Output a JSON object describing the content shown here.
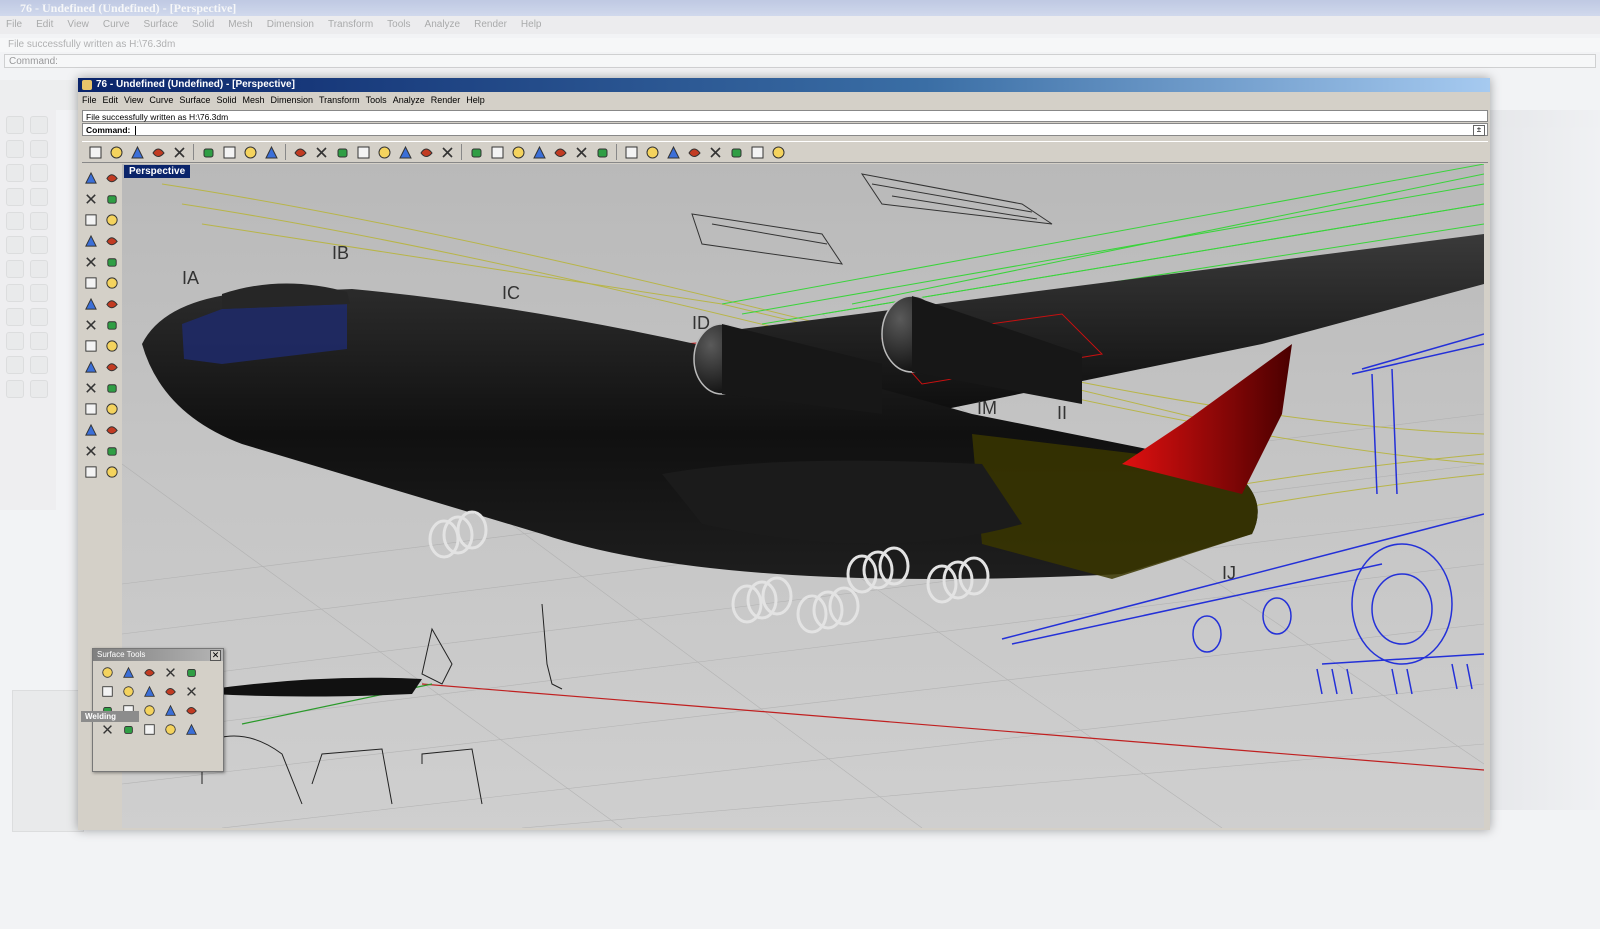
{
  "background_window": {
    "title": "76 - Undefined (Undefined) - [Perspective]",
    "menu": [
      "File",
      "Edit",
      "View",
      "Curve",
      "Surface",
      "Solid",
      "Mesh",
      "Dimension",
      "Transform",
      "Tools",
      "Analyze",
      "Render",
      "Help"
    ],
    "status": "File successfully written as H:\\76.3dm",
    "command_label": "Command:"
  },
  "window": {
    "title": "76 - Undefined (Undefined) - [Perspective]"
  },
  "menu": [
    "File",
    "Edit",
    "View",
    "Curve",
    "Surface",
    "Solid",
    "Mesh",
    "Dimension",
    "Transform",
    "Tools",
    "Analyze",
    "Render",
    "Help"
  ],
  "status_line": "File successfully written as H:\\76.3dm",
  "command": {
    "label": "Command:",
    "value": ""
  },
  "toolbar_icons": [
    "new-icon",
    "open-icon",
    "save-icon",
    "print-icon",
    "import-icon",
    "cut-icon",
    "copy-icon",
    "paste-icon",
    "undo-icon",
    "pan-hand-icon",
    "move-icon",
    "zoom-icon",
    "zoom-window-icon",
    "zoom-extents-icon",
    "zoom-selected-icon",
    "rotate-view-icon",
    "four-viewports-icon",
    "hide-icon",
    "show-icon",
    "layer-icon",
    "snap-icon",
    "bulb-icon",
    "lock-icon",
    "properties-icon",
    "color-wheel-icon",
    "sphere-wire-icon",
    "sphere-shade-icon",
    "render-icon",
    "analyze-icon",
    "settings-gear-icon",
    "options-icon",
    "help-icon"
  ],
  "sidebar_icons": [
    "select-arrow-icon",
    "point-icon",
    "polyline-icon",
    "curve-points-icon",
    "circle-icon",
    "ellipse-icon",
    "polygon-icon",
    "rectangle-icon",
    "arc-icon",
    "fillet-curve-icon",
    "surface-corner-icon",
    "surface-edge-icon",
    "box-icon",
    "sphere-icon",
    "cylinder-icon",
    "plane-icon",
    "boolean-icon",
    "explode-icon",
    "split-icon",
    "trim-icon",
    "mesh-icon",
    "group-icon",
    "fillet-icon",
    "offset-icon",
    "text-icon",
    "dimension-icon",
    "array-icon",
    "transform-icon",
    "render-mesh-icon",
    "grid-icon"
  ],
  "viewport": {
    "label": "Perspective"
  },
  "drawing_labels": [
    "IA",
    "IB",
    "IC",
    "ID",
    "IM",
    "II",
    "IJ"
  ],
  "surface_palette": {
    "title": "Surface Tools",
    "subgroup_title": "Welding",
    "close_glyph": "✕"
  },
  "colors": {
    "title_gradient_start": "#0a246a",
    "wire_green": "#39d43a",
    "wire_yellow": "#b8b548",
    "wire_blue": "#2330d8",
    "tail_red": "#c10a0a",
    "fuselage": "#141414"
  }
}
